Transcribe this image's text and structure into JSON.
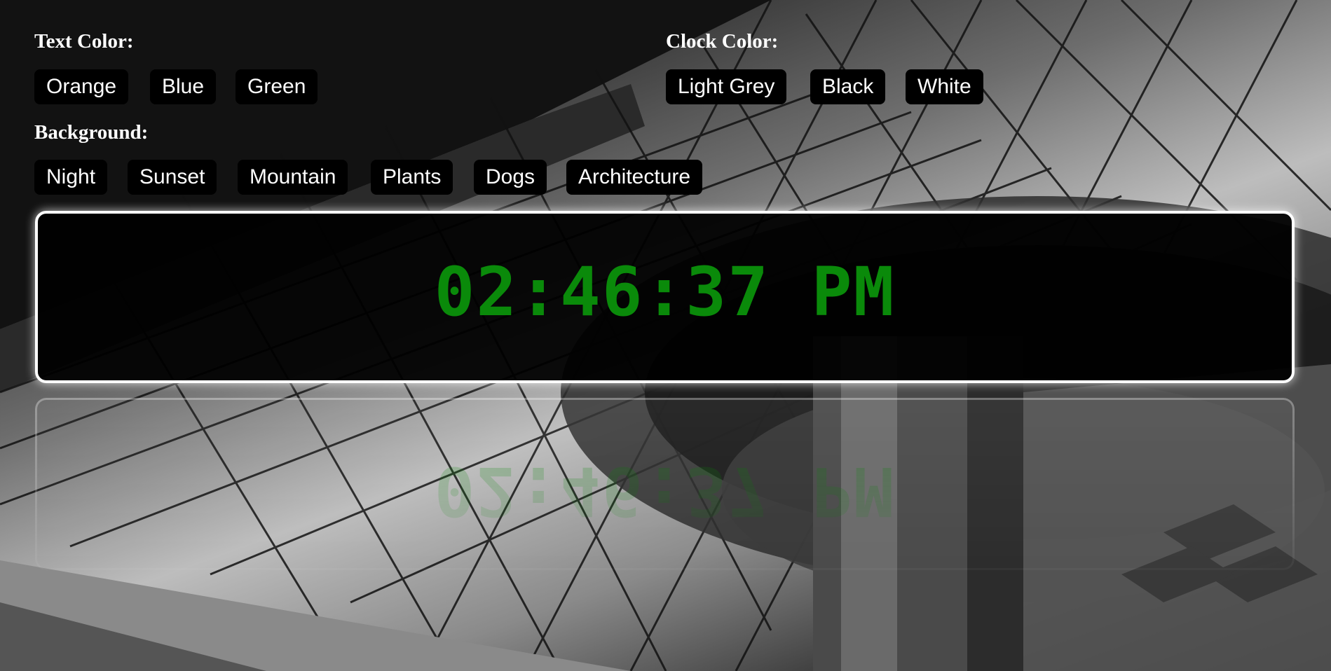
{
  "controls": {
    "text_color": {
      "label": "Text Color:",
      "options": [
        "Orange",
        "Blue",
        "Green"
      ]
    },
    "clock_color": {
      "label": "Clock Color:",
      "options": [
        "Light Grey",
        "Black",
        "White"
      ]
    },
    "background": {
      "label": "Background:",
      "options": [
        "Night",
        "Sunset",
        "Mountain",
        "Plants",
        "Dogs",
        "Architecture"
      ]
    }
  },
  "clock": {
    "time": "02:46:37 PM",
    "text_color": "#0a8a0a",
    "panel_color": "#000000",
    "border_color": "#ffffff"
  },
  "background_image": "architecture"
}
